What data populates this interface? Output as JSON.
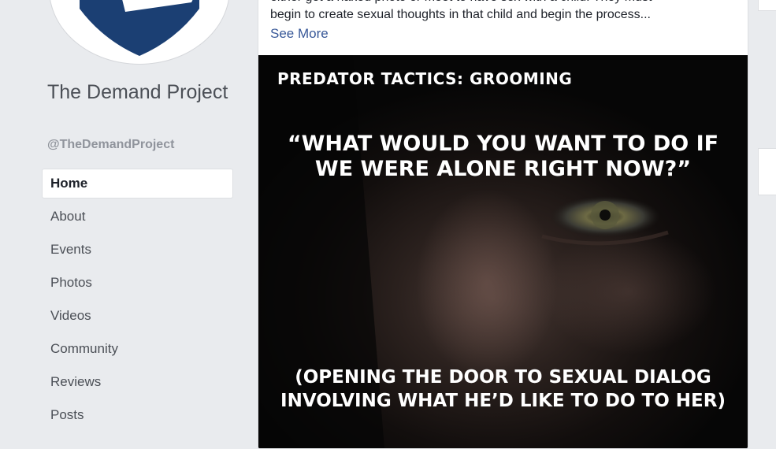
{
  "page": {
    "name": "The Demand Project",
    "handle": "@TheDemandProject"
  },
  "colors": {
    "background": "#e9ebee",
    "logo_blue": "#1b3f73",
    "link": "#385898",
    "nav_text": "#4b4f56"
  },
  "icons": {
    "logo": "shield-logo-icon"
  },
  "nav": {
    "items": [
      {
        "label": "Home",
        "active": true
      },
      {
        "label": "About",
        "active": false
      },
      {
        "label": "Events",
        "active": false
      },
      {
        "label": "Photos",
        "active": false
      },
      {
        "label": "Videos",
        "active": false
      },
      {
        "label": "Community",
        "active": false
      },
      {
        "label": "Reviews",
        "active": false
      },
      {
        "label": "Posts",
        "active": false
      }
    ]
  },
  "post": {
    "text_line_clipped": "either get a naked photo or meet to have sex with a child. They must",
    "text_line": "begin to create sexual thoughts in that child and begin the process...",
    "see_more": "See More",
    "image": {
      "title": "PREDATOR TACTICS: GROOMING",
      "quote_line_1": "“WHAT WOULD YOU WANT TO DO IF",
      "quote_line_2": "WE WERE ALONE RIGHT NOW?”",
      "caption_line_1": "(OPENING THE DOOR TO SEXUAL DIALOG",
      "caption_line_2": "INVOLVING WHAT HE’D LIKE TO DO TO HER)"
    }
  }
}
